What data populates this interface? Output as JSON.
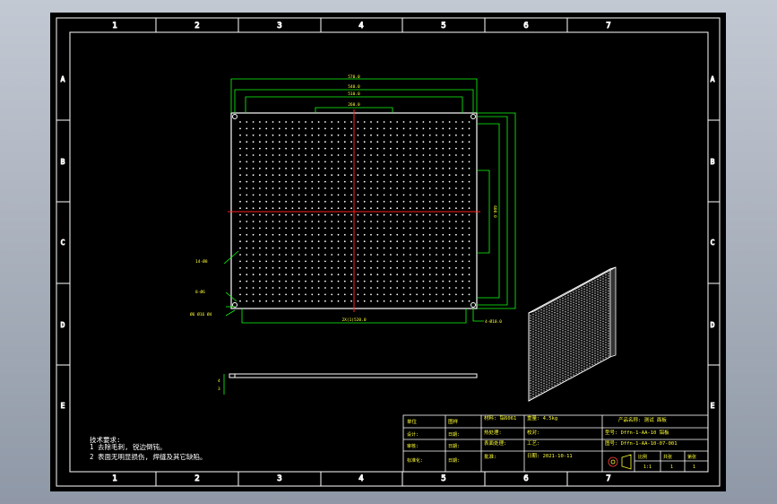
{
  "sheet": {
    "colors": {
      "background": "#000000",
      "frame": "#ffffff",
      "dimension": "#11ff11",
      "text": "#ffff33",
      "centerline": "#ff2020"
    },
    "col_labels": [
      "1",
      "2",
      "3",
      "4",
      "5",
      "6",
      "7"
    ],
    "row_labels": [
      "A",
      "B",
      "C",
      "D",
      "E"
    ]
  },
  "dims": {
    "top_overall": "570.0",
    "top_2": "540.0",
    "top_3": "510.0",
    "top_inner": "260.0",
    "bottom": "2X(1)520.0",
    "bottom_right": "4-Ø10.0",
    "hole_grid": "14-Ø8",
    "side_pitch": "600.0",
    "callout_1": "8-Ø6",
    "callout_2": "Ø6 Ø16 Ø4",
    "section_1": "4",
    "section_2": "3"
  },
  "notes": {
    "title": "技术要求:",
    "line_1": "1 去除毛刺, 锐边倒钝。",
    "line_2": "2 表面无明显损伤, 焊缝及其它缺陷。"
  },
  "title_block": {
    "r1_c1": "单位",
    "r1_c2": "图样",
    "r1_c3": "材料: 铝6061",
    "r1_c4": "重量: 4.5kg",
    "r1_c5": "产品名称: 测试 面板",
    "r2_c1": "设计:",
    "r2_c2": "日期:",
    "r2_c3": "热处理:",
    "r2_c4": "校对:",
    "r2_c5": "型号: Dffn-1-AA-10 铝板",
    "r3_c1": "审核:",
    "r3_c2": "日期:",
    "r3_c3": "表面处理:",
    "r3_c4": "工艺:",
    "r3_c5": "图号: Dffn-1-AA-10-07-001",
    "r4_c1": "标准化:",
    "r4_c2": "日期:",
    "r4_c3": "批准:",
    "r4_c4": "日期: 2021-10-11",
    "scale_label": "比例",
    "sheets_label": "共张",
    "sheet_no_label": "第张",
    "scale": "1:1",
    "sheets": "1",
    "sheet_no": "1"
  }
}
